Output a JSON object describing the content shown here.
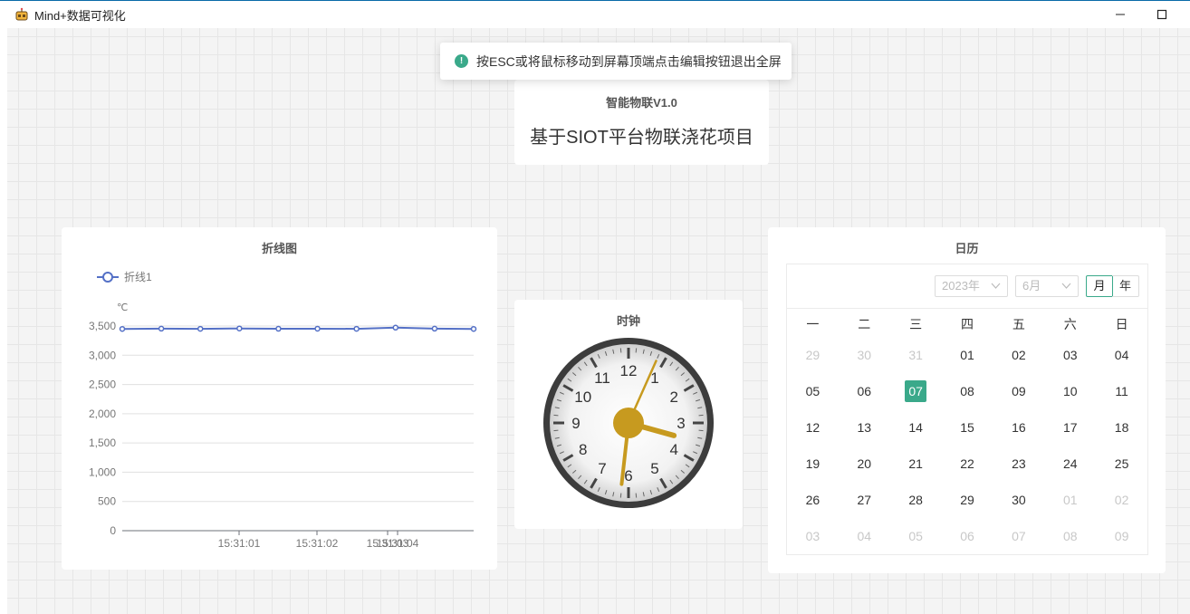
{
  "window": {
    "title": "Mind+数据可视化"
  },
  "toast": {
    "text": "按ESC或将鼠标移动到屏幕顶端点击编辑按钮退出全屏"
  },
  "header": {
    "subtitle": "智能物联V1.0",
    "title": "基于SIOT平台物联浇花项目"
  },
  "line_chart": {
    "card_title": "折线图",
    "legend": "折线1",
    "unit": "℃"
  },
  "chart_data": {
    "type": "line",
    "title": "折线图",
    "ylabel": "℃",
    "series": [
      {
        "name": "折线1",
        "color": "#5470c6",
        "values": [
          3450,
          3455,
          3452,
          3458,
          3453,
          3454,
          3452,
          3472,
          3455,
          3450
        ]
      }
    ],
    "ylim": [
      0,
      3500
    ],
    "yticks": [
      0,
      500,
      1000,
      1500,
      2000,
      2500,
      3000,
      3500
    ],
    "ytick_labels": [
      "0",
      "500",
      "1,000",
      "1,500",
      "2,000",
      "2,500",
      "3,000",
      "3,500"
    ],
    "xtick_labels": [
      "15:31:01",
      "15:31:02",
      "15:31:03",
      "15:31:04"
    ],
    "grid": true,
    "legend_position": "top-left"
  },
  "clock": {
    "card_title": "时钟",
    "numbers": [
      "12",
      "1",
      "2",
      "3",
      "4",
      "5",
      "6",
      "7",
      "8",
      "9",
      "10",
      "11"
    ],
    "time": {
      "hour": 3,
      "minute": 31,
      "second": 4
    }
  },
  "calendar": {
    "card_title": "日历",
    "year_select": "2023年",
    "month_select": "6月",
    "mode_month": "月",
    "mode_year": "年",
    "weekdays": [
      "一",
      "二",
      "三",
      "四",
      "五",
      "六",
      "日"
    ],
    "weeks": [
      [
        {
          "d": "29",
          "m": true
        },
        {
          "d": "30",
          "m": true
        },
        {
          "d": "31",
          "m": true
        },
        {
          "d": "01"
        },
        {
          "d": "02"
        },
        {
          "d": "03"
        },
        {
          "d": "04"
        }
      ],
      [
        {
          "d": "05"
        },
        {
          "d": "06"
        },
        {
          "d": "07",
          "today": true
        },
        {
          "d": "08"
        },
        {
          "d": "09"
        },
        {
          "d": "10"
        },
        {
          "d": "11"
        }
      ],
      [
        {
          "d": "12"
        },
        {
          "d": "13"
        },
        {
          "d": "14"
        },
        {
          "d": "15"
        },
        {
          "d": "16"
        },
        {
          "d": "17"
        },
        {
          "d": "18"
        }
      ],
      [
        {
          "d": "19"
        },
        {
          "d": "20"
        },
        {
          "d": "21"
        },
        {
          "d": "22"
        },
        {
          "d": "23"
        },
        {
          "d": "24"
        },
        {
          "d": "25"
        }
      ],
      [
        {
          "d": "26"
        },
        {
          "d": "27"
        },
        {
          "d": "28"
        },
        {
          "d": "29"
        },
        {
          "d": "30"
        },
        {
          "d": "01",
          "m": true
        },
        {
          "d": "02",
          "m": true
        }
      ],
      [
        {
          "d": "03",
          "m": true
        },
        {
          "d": "04",
          "m": true
        },
        {
          "d": "05",
          "m": true
        },
        {
          "d": "06",
          "m": true
        },
        {
          "d": "07",
          "m": true
        },
        {
          "d": "08",
          "m": true
        },
        {
          "d": "09",
          "m": true
        }
      ]
    ],
    "accent": "#3aa98a"
  }
}
